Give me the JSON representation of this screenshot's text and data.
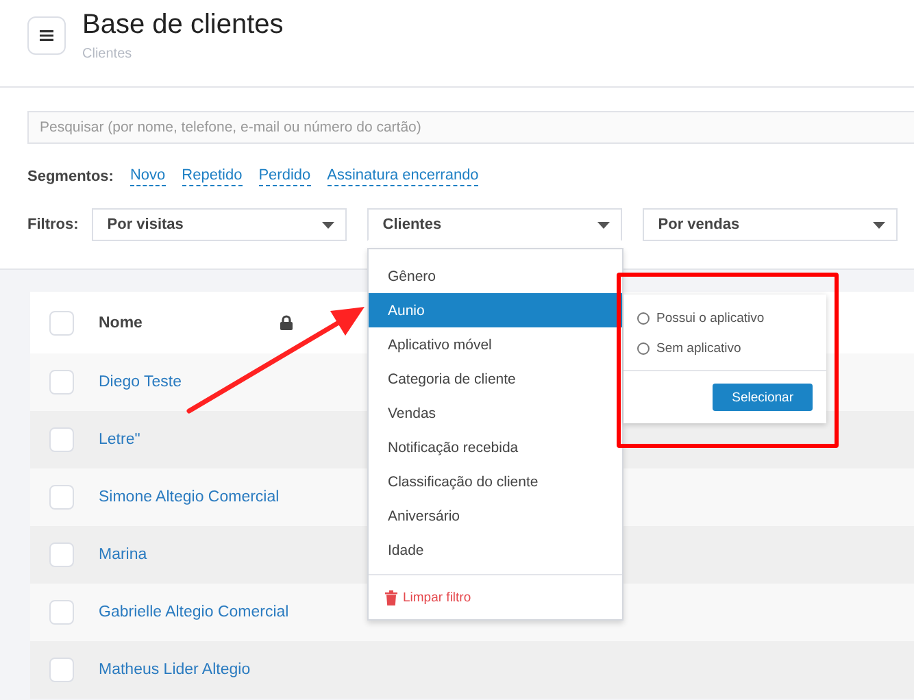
{
  "header": {
    "title": "Base de clientes",
    "breadcrumb": "Clientes"
  },
  "search": {
    "placeholder": "Pesquisar (por nome, telefone, e-mail ou número do cartão)"
  },
  "segments": {
    "label": "Segmentos:",
    "items": [
      "Novo",
      "Repetido",
      "Perdido",
      "Assinatura encerrando"
    ]
  },
  "filters": {
    "label": "Filtros:",
    "selects": [
      {
        "value": "Por visitas",
        "open": false
      },
      {
        "value": "Clientes",
        "open": true
      },
      {
        "value": "Por vendas",
        "open": false
      }
    ]
  },
  "table": {
    "columns": [
      "Nome"
    ],
    "select_all_checked": false,
    "rows": [
      {
        "name": "Diego Teste",
        "checked": false
      },
      {
        "name": "Letre\"",
        "checked": false
      },
      {
        "name": "Simone Altegio Comercial",
        "checked": false
      },
      {
        "name": "Marina",
        "checked": false
      },
      {
        "name": "Gabrielle Altegio Comercial",
        "checked": false
      },
      {
        "name": "Matheus Lider Altegio",
        "checked": false
      }
    ]
  },
  "dropdown": {
    "items": [
      {
        "label": "Gênero",
        "selected": false
      },
      {
        "label": "Aunio",
        "selected": true
      },
      {
        "label": "Aplicativo móvel",
        "selected": false
      },
      {
        "label": "Categoria de cliente",
        "selected": false
      },
      {
        "label": "Vendas",
        "selected": false
      },
      {
        "label": "Notificação recebida",
        "selected": false
      },
      {
        "label": "Classificação do cliente",
        "selected": false
      },
      {
        "label": "Aniversário",
        "selected": false
      },
      {
        "label": "Idade",
        "selected": false
      }
    ],
    "clear": "Limpar filtro"
  },
  "popup": {
    "options": [
      {
        "label": "Possui o aplicativo",
        "selected": false
      },
      {
        "label": "Sem aplicativo",
        "selected": false
      }
    ],
    "button": "Selecionar"
  }
}
